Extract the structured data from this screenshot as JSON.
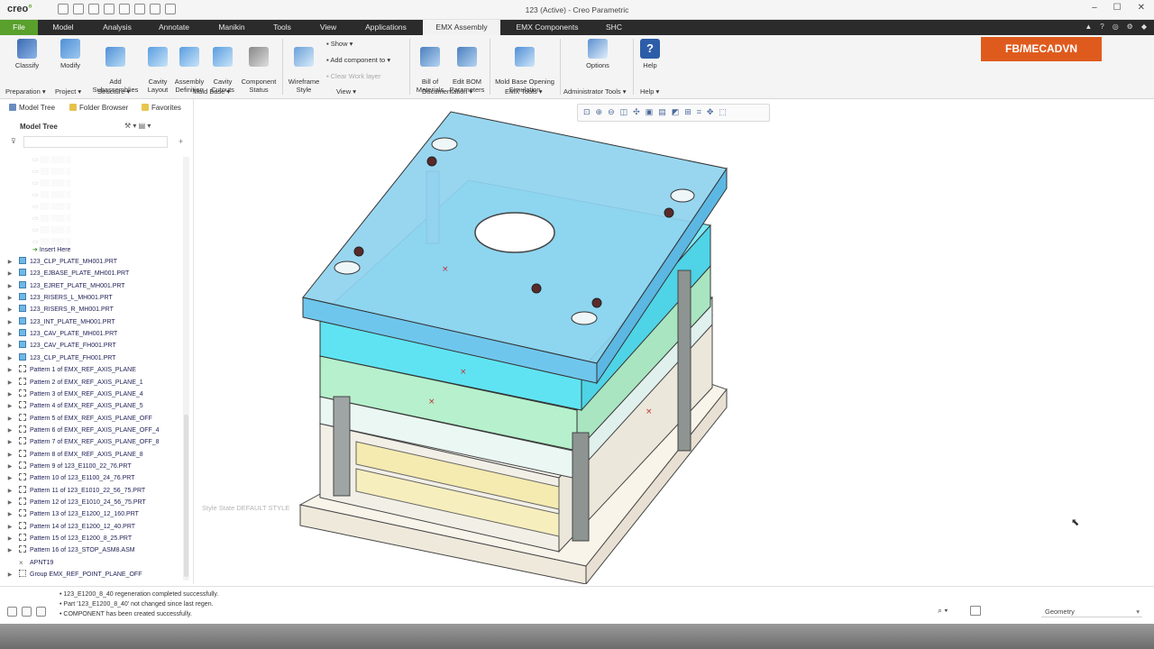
{
  "app": {
    "logo_text": "creo",
    "window_title": "123 (Active) - Creo Parametric",
    "watermark": "FB/MECADVN"
  },
  "tabs": [
    {
      "label": "File"
    },
    {
      "label": "Model"
    },
    {
      "label": "Analysis"
    },
    {
      "label": "Annotate"
    },
    {
      "label": "Manikin"
    },
    {
      "label": "Tools"
    },
    {
      "label": "View"
    },
    {
      "label": "Applications"
    },
    {
      "label": "EMX Assembly"
    },
    {
      "label": "EMX Components"
    },
    {
      "label": "SHC"
    }
  ],
  "ribbon": {
    "buttons": [
      {
        "label": "Classify"
      },
      {
        "label": "Modify"
      },
      {
        "label": "Add\nSubassemblies"
      },
      {
        "label": "Cavity\nLayout"
      },
      {
        "label": "Assembly\nDefinition"
      },
      {
        "label": "Cavity\nCutouts"
      },
      {
        "label": "Component\nStatus"
      },
      {
        "label": "Wireframe\nStyle"
      },
      {
        "label": "Bill of\nMaterials"
      },
      {
        "label": "Edit BOM\nParameters"
      },
      {
        "label": "Mold Base Opening\nSimulation"
      },
      {
        "label": "Options"
      },
      {
        "label": "Help"
      }
    ],
    "small": {
      "show": "Show",
      "add_component": "Add component to",
      "clear_work_layer": "Clear Work layer"
    },
    "groups": [
      {
        "label": "Preparation"
      },
      {
        "label": "Project"
      },
      {
        "label": "Structure"
      },
      {
        "label": "Mold Base"
      },
      {
        "label": "View"
      },
      {
        "label": "Documentation"
      },
      {
        "label": "EMX Tools"
      },
      {
        "label": "Administrator Tools"
      },
      {
        "label": "Help"
      }
    ]
  },
  "panel": {
    "tabs": [
      {
        "label": "Model Tree"
      },
      {
        "label": "Folder Browser"
      },
      {
        "label": "Favorites"
      }
    ],
    "header": "Model Tree",
    "insert_here": "Insert Here",
    "items": [
      "123_CLP_PLATE_MH001.PRT",
      "123_EJBASE_PLATE_MH001.PRT",
      "123_EJRET_PLATE_MH001.PRT",
      "123_RISERS_L_MH001.PRT",
      "123_RISERS_R_MH001.PRT",
      "123_INT_PLATE_MH001.PRT",
      "123_CAV_PLATE_MH001.PRT",
      "123_CAV_PLATE_FH001.PRT",
      "123_CLP_PLATE_FH001.PRT",
      "Pattern 1 of EMX_REF_AXIS_PLANE",
      "Pattern 2 of EMX_REF_AXIS_PLANE_1",
      "Pattern 3 of EMX_REF_AXIS_PLANE_4",
      "Pattern 4 of EMX_REF_AXIS_PLANE_5",
      "Pattern 5 of EMX_REF_AXIS_PLANE_OFF",
      "Pattern 6 of EMX_REF_AXIS_PLANE_OFF_4",
      "Pattern 7 of EMX_REF_AXIS_PLANE_OFF_8",
      "Pattern 8 of EMX_REF_AXIS_PLANE_8",
      "Pattern 9 of 123_E1100_22_76.PRT",
      "Pattern 10 of 123_E1100_24_76.PRT",
      "Pattern 11 of 123_E1010_22_56_75.PRT",
      "Pattern 12 of 123_E1010_24_56_75.PRT",
      "Pattern 13 of 123_E1200_12_160.PRT",
      "Pattern 14 of 123_E1200_12_40.PRT",
      "Pattern 15 of 123_E1200_8_25.PRT",
      "Pattern 16 of 123_STOP_ASM8.ASM",
      "APNT19",
      "Group EMX_REF_POINT_PLANE_OFF"
    ]
  },
  "viewport": {
    "style_state": "Style State DEFAULT STYLE"
  },
  "messages": [
    "123_E1200_8_40 regeneration completed successfully.",
    "Part '123_E1200_8_40' not changed since last regen.",
    "COMPONENT has been created successfully."
  ],
  "status": {
    "filter_value": "Geometry"
  },
  "colors": {
    "file_tab": "#5aa02c",
    "tab_bar": "#2b2b2b",
    "badge": "#df5b1d",
    "plate_cyan": "#5fe3f2",
    "plate_blue": "#6fc6ec",
    "plate_yellow": "#f6eab2"
  }
}
